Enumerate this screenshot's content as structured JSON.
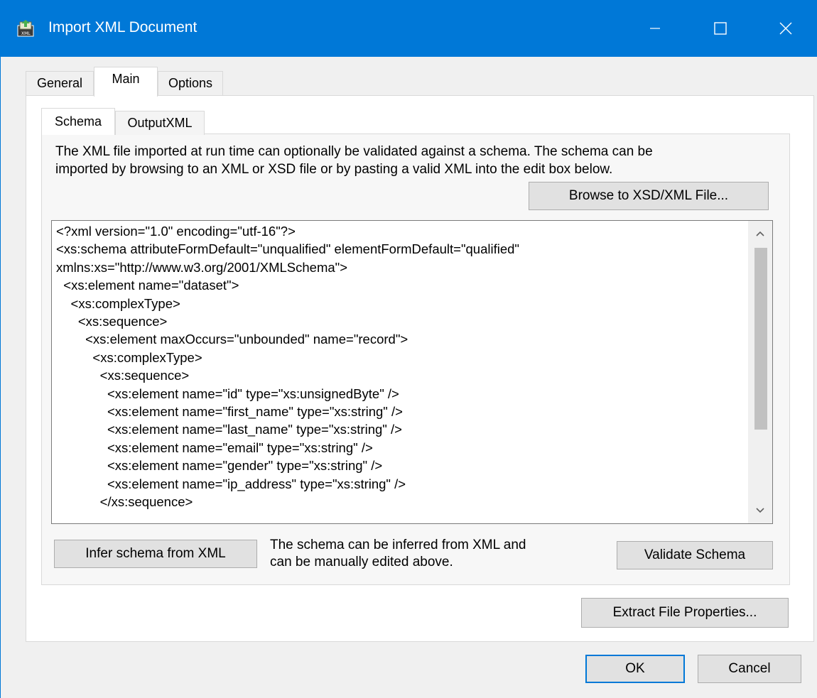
{
  "window": {
    "title": "Import XML Document",
    "accent_color": "#0078d7",
    "icon": "import-xml-icon"
  },
  "tabs": {
    "general": "General",
    "main": "Main",
    "options": "Options",
    "active": "Main"
  },
  "subtabs": {
    "schema": "Schema",
    "output": "OutputXML",
    "active": "Schema"
  },
  "schema": {
    "description_line1": "The XML file imported at run time can optionally be validated against a schema. The schema can be",
    "description_line2": "imported by browsing to an XML or XSD file or by pasting a valid XML into the edit box below.",
    "browse_label": "Browse to XSD/XML File...",
    "editor_lines": [
      "<?xml version=\"1.0\" encoding=\"utf-16\"?>",
      "<xs:schema attributeFormDefault=\"unqualified\" elementFormDefault=\"qualified\"",
      "xmlns:xs=\"http://www.w3.org/2001/XMLSchema\">",
      "  <xs:element name=\"dataset\">",
      "    <xs:complexType>",
      "      <xs:sequence>",
      "        <xs:element maxOccurs=\"unbounded\" name=\"record\">",
      "          <xs:complexType>",
      "            <xs:sequence>",
      "              <xs:element name=\"id\" type=\"xs:unsignedByte\" />",
      "              <xs:element name=\"first_name\" type=\"xs:string\" />",
      "              <xs:element name=\"last_name\" type=\"xs:string\" />",
      "              <xs:element name=\"email\" type=\"xs:string\" />",
      "              <xs:element name=\"gender\" type=\"xs:string\" />",
      "              <xs:element name=\"ip_address\" type=\"xs:string\" />",
      "            </xs:sequence>"
    ],
    "infer_label": "Infer schema from XML",
    "infer_note_line1": "The schema can be inferred from XML and",
    "infer_note_line2": "can be manually edited above.",
    "validate_label": "Validate Schema"
  },
  "footer": {
    "extract_label": "Extract File Properties...",
    "ok_label": "OK",
    "cancel_label": "Cancel"
  }
}
